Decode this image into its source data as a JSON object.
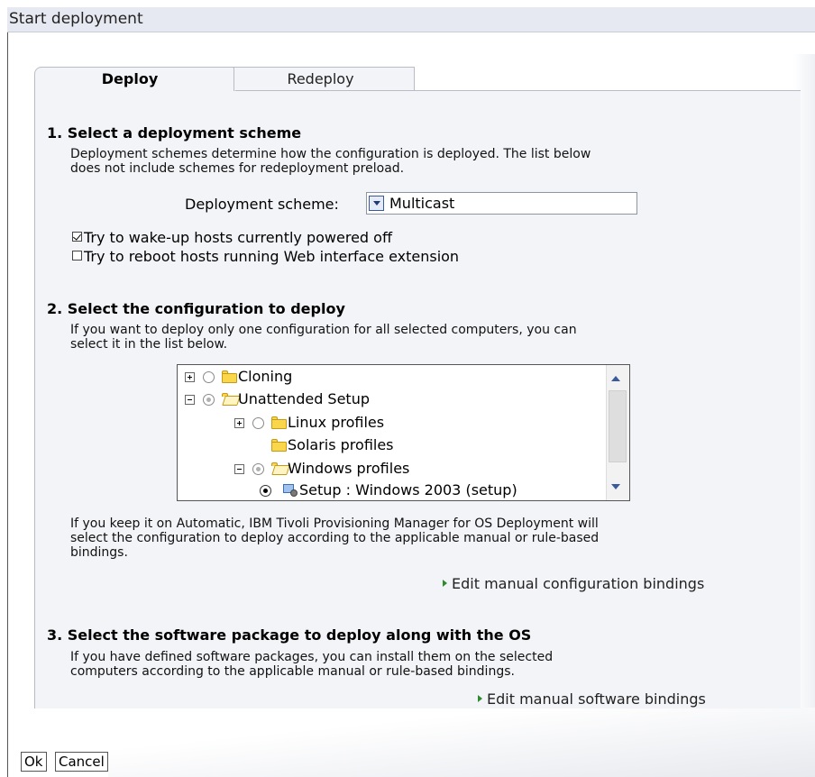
{
  "window": {
    "title": "Start deployment"
  },
  "tabs": [
    {
      "label": "Deploy",
      "active": true
    },
    {
      "label": "Redeploy",
      "active": false
    }
  ],
  "section1": {
    "heading": "1. Select a deployment scheme",
    "desc_line1": "Deployment schemes determine how the configuration is deployed. The list below",
    "desc_line2": "does not include schemes for redeployment preload.",
    "scheme_label": "Deployment scheme:",
    "scheme_value": "Multicast",
    "options": [
      {
        "label": "Try to wake-up hosts currently powered off",
        "checked": true
      },
      {
        "label": "Try to reboot hosts running Web interface extension",
        "checked": false
      }
    ]
  },
  "section2": {
    "heading": "2. Select the configuration to deploy",
    "desc_line1": "If you want to deploy only one configuration for all selected computers, you can",
    "desc_line2": "select it in the list below.",
    "tree": [
      {
        "label": "Cloning",
        "expander": "plus",
        "radio": "off",
        "icon": "folder-icon"
      },
      {
        "label": "Unattended Setup",
        "expander": "minus",
        "radio": "partial",
        "icon": "folder-open-icon"
      },
      {
        "label": "Linux profiles",
        "expander": "plus",
        "radio": "off",
        "icon": "folder-icon"
      },
      {
        "label": "Solaris profiles",
        "expander": "",
        "radio": "",
        "icon": "folder-icon"
      },
      {
        "label": "Windows profiles",
        "expander": "minus",
        "radio": "partial",
        "icon": "folder-open-icon"
      },
      {
        "label": "Setup : Windows 2003 (setup)",
        "expander": "",
        "radio": "on",
        "icon": "computer-icon"
      }
    ],
    "note_line1": "If you keep it on Automatic, IBM Tivoli Provisioning Manager for OS Deployment will",
    "note_line2": "select the configuration to deploy according to the applicable manual or rule-based",
    "note_line3": "bindings.",
    "link": "Edit manual configuration bindings"
  },
  "section3": {
    "heading": "3. Select the software package to deploy along with the OS",
    "desc_line1": "If you have defined software packages, you can install them on the selected",
    "desc_line2": "computers according to the applicable manual or rule-based bindings.",
    "link": "Edit manual software bindings"
  },
  "buttons": {
    "ok": "Ok",
    "cancel": "Cancel"
  },
  "colors": {
    "title_bar": "#e6e9f1",
    "panel": "#f3f4f8",
    "link_arrow": "#2e8b2e",
    "folder": "#f9d64a"
  }
}
